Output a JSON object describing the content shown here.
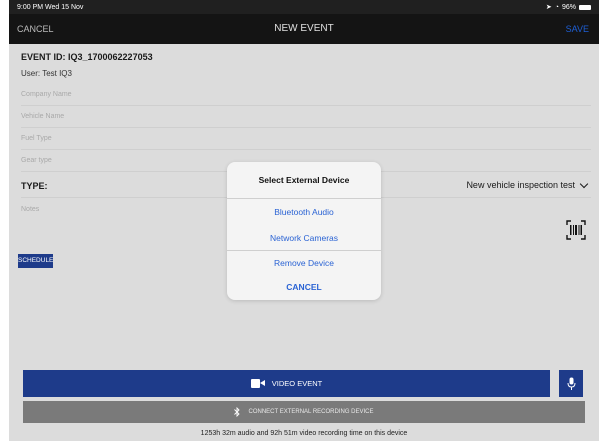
{
  "status_bar": {
    "time": "9:00 PM Wed 15 Nov",
    "battery": "96%"
  },
  "nav": {
    "cancel_label": "CANCEL",
    "title": "NEW EVENT",
    "save_label": "SAVE"
  },
  "form": {
    "event_id": "EVENT ID: IQ3_1700062227053",
    "user": "User: Test IQ3",
    "fields": {
      "company_placeholder": "Company Name",
      "vehicle_placeholder": "Vehicle Name",
      "fuel_placeholder": "Fuel Type",
      "gear_placeholder": "Gear type"
    },
    "type_label": "TYPE:",
    "type_value": "New vehicle inspection test",
    "notes_placeholder": "Notes",
    "schedule_label": "SCHEDULE"
  },
  "bottom": {
    "video_event_label": "VIDEO EVENT",
    "connect_label": "CONNECT EXTERNAL RECORDING DEVICE",
    "recording_time": "1253h 32m audio and 92h 51m video recording time on this device"
  },
  "modal": {
    "title": "Select External Device",
    "options": [
      "Bluetooth Audio",
      "Network Cameras",
      "Remove Device"
    ],
    "cancel_label": "CANCEL"
  },
  "colors": {
    "accent_blue": "#1e3b8a",
    "link_blue": "#2a63d4",
    "nav_dark": "#141414",
    "connect_gray": "#7a7a7a"
  },
  "icons": {
    "status_icons": [
      "location-icon",
      "wifi-icon",
      "battery-icon"
    ],
    "barcode": "barcode-scan-icon",
    "video": "video-camera-icon",
    "mic": "microphone-icon",
    "bluetooth": "bluetooth-icon"
  }
}
